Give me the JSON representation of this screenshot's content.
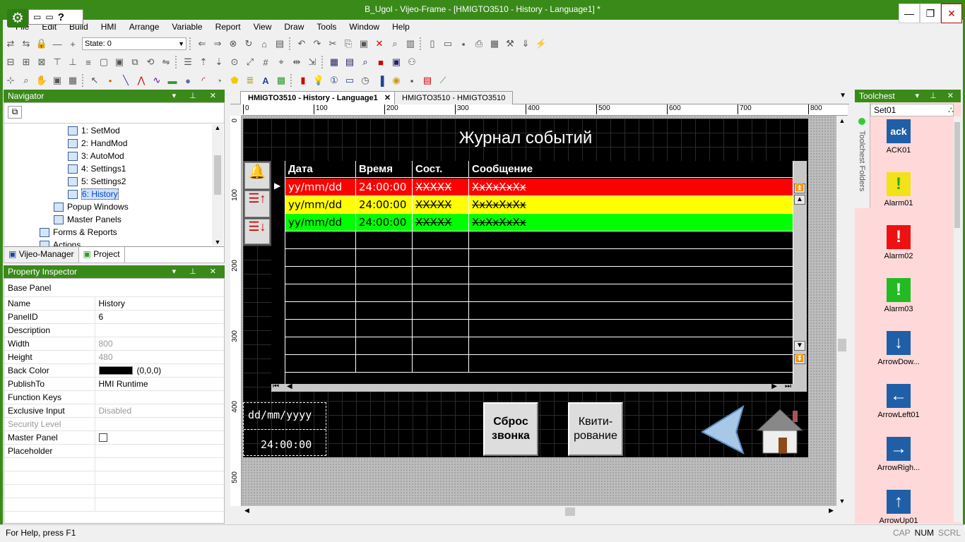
{
  "window": {
    "title": "B_Ugol - Vijeo-Frame - [HMIGTO3510 - History - Language1] *",
    "minimize": "—",
    "restore": "❐",
    "close": "✕"
  },
  "menu": [
    "File",
    "Edit",
    "Build",
    "HMI",
    "Arrange",
    "Variable",
    "Report",
    "View",
    "Draw",
    "Tools",
    "Window",
    "Help"
  ],
  "toolbar": {
    "state_label": "State: 0"
  },
  "navigator": {
    "title": "Navigator",
    "items": [
      {
        "label": "1: SetMod",
        "indent": 90
      },
      {
        "label": "2: HandMod",
        "indent": 90
      },
      {
        "label": "3: AutoMod",
        "indent": 90
      },
      {
        "label": "4: Settings1",
        "indent": 90
      },
      {
        "label": "5: Settings2",
        "indent": 90
      },
      {
        "label": "6: History",
        "indent": 90
      },
      {
        "label": "Popup Windows",
        "indent": 70
      },
      {
        "label": "Master Panels",
        "indent": 70
      },
      {
        "label": "Forms & Reports",
        "indent": 50
      },
      {
        "label": "Actions",
        "indent": 50
      }
    ],
    "tabs": [
      "Vijeo-Manager",
      "Project"
    ]
  },
  "property_inspector": {
    "title": "Property Inspector",
    "rows": [
      {
        "k": "Base Panel",
        "v": ""
      },
      {
        "k": "Name",
        "v": "History"
      },
      {
        "k": "PanelID",
        "v": "6"
      },
      {
        "k": "Description",
        "v": ""
      },
      {
        "k": "Width",
        "v": "800"
      },
      {
        "k": "Height",
        "v": "480"
      },
      {
        "k": "Back Color",
        "v": "(0,0,0)"
      },
      {
        "k": "PublishTo",
        "v": "HMI Runtime"
      },
      {
        "k": "Function Keys",
        "v": ""
      },
      {
        "k": "Exclusive Input",
        "v": "Disabled"
      },
      {
        "k": "Security Level",
        "v": ""
      },
      {
        "k": "Master Panel",
        "v": ""
      },
      {
        "k": "Placeholder",
        "v": ""
      },
      {
        "k": "",
        "v": ""
      },
      {
        "k": "",
        "v": ""
      },
      {
        "k": "",
        "v": ""
      },
      {
        "k": "",
        "v": ""
      }
    ]
  },
  "doc_tabs": [
    "HMIGTO3510 - History - Language1",
    "HMIGTO3510 - HMIGTO3510"
  ],
  "ruler": {
    "h": [
      "0",
      "100",
      "200",
      "300",
      "400",
      "500",
      "600",
      "700",
      "800"
    ],
    "v": [
      "0",
      "100",
      "200",
      "300",
      "400",
      "500"
    ]
  },
  "screen": {
    "title": "Журнал событий",
    "columns": [
      "Дата",
      "Время",
      "Сост.",
      "Сообщение"
    ],
    "rows": [
      {
        "date": "yy/mm/dd",
        "time": "24:00:00",
        "state": "XXXXX",
        "msg": "XxXxXxXx",
        "bg": "#ff0000",
        "fg": "#ffffff"
      },
      {
        "date": "yy/mm/dd",
        "time": "24:00:00",
        "state": "XXXXX",
        "msg": "XxXxXxXx",
        "bg": "#ffff00",
        "fg": "#000000"
      },
      {
        "date": "yy/mm/dd",
        "time": "24:00:00",
        "state": "XXXXX",
        "msg": "XxXxXxXx",
        "bg": "#00ff00",
        "fg": "#000000"
      }
    ],
    "date_format": "dd/mm/yyyy",
    "time_value": "24:00:00",
    "reset_btn": [
      "Сброс",
      "звонка"
    ],
    "ack_btn": [
      "Квити-",
      "рование"
    ]
  },
  "toolchest": {
    "title": "Toolchest",
    "set": "Set01",
    "folders_label": "Toolchest Folders",
    "items": [
      {
        "label": "ACK01",
        "icon": "ack-icon"
      },
      {
        "label": "Alarm01",
        "icon": "alarm-yellow-icon"
      },
      {
        "label": "Alarm02",
        "icon": "alarm-red-icon"
      },
      {
        "label": "Alarm03",
        "icon": "alarm-green-icon"
      },
      {
        "label": "ArrowDow...",
        "icon": "arrow-down-icon"
      },
      {
        "label": "ArrowLeft01",
        "icon": "arrow-left-icon"
      },
      {
        "label": "ArrowRigh...",
        "icon": "arrow-right-icon"
      },
      {
        "label": "ArrowUp01",
        "icon": "arrow-up-icon"
      }
    ]
  },
  "status": {
    "help": "For Help, press F1",
    "cap": "CAP",
    "num": "NUM",
    "scrl": "SCRL"
  }
}
